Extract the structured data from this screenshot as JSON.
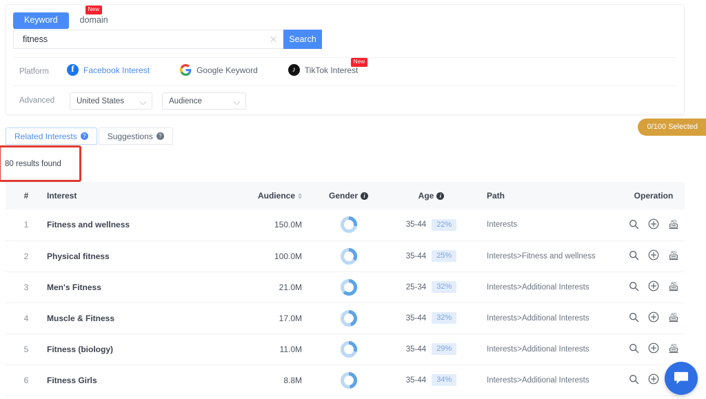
{
  "search_panel": {
    "mode_tabs": [
      {
        "label": "Keyword",
        "active": true,
        "badge": null
      },
      {
        "label": "domain",
        "active": false,
        "badge": "New"
      }
    ],
    "search_value": "fitness",
    "search_placeholder": "",
    "search_button": "Search",
    "platform_label": "Platform",
    "platforms": [
      {
        "label": "Facebook Interest",
        "icon": "facebook-icon",
        "active": true,
        "badge": null
      },
      {
        "label": "Google Keyword",
        "icon": "google-icon",
        "active": false,
        "badge": null
      },
      {
        "label": "TikTok Interest",
        "icon": "tiktok-icon",
        "active": false,
        "badge": "New"
      }
    ],
    "advanced_label": "Advanced",
    "advanced_selects": [
      {
        "value": "United States"
      },
      {
        "value": "Audience"
      }
    ]
  },
  "result_tabs": [
    {
      "label": "Related Interests",
      "active": true
    },
    {
      "label": "Suggestions",
      "active": false
    }
  ],
  "results_found": "80 results found",
  "selected_badge": "0/100 Selected",
  "table": {
    "columns": [
      {
        "key": "num",
        "label": "#"
      },
      {
        "key": "int",
        "label": "Interest"
      },
      {
        "key": "aud",
        "label": "Audience",
        "sortable": true
      },
      {
        "key": "gen",
        "label": "Gender",
        "info": true
      },
      {
        "key": "age",
        "label": "Age",
        "info": true
      },
      {
        "key": "path",
        "label": "Path"
      },
      {
        "key": "op",
        "label": "Operation"
      }
    ],
    "rows": [
      {
        "num": "1",
        "interest": "Fitness and wellness",
        "audience": "150.0M",
        "gender_pct": 28,
        "age_range": "35-44",
        "age_pct": "22%",
        "path": "Interests"
      },
      {
        "num": "2",
        "interest": "Physical fitness",
        "audience": "100.0M",
        "gender_pct": 34,
        "age_range": "35-44",
        "age_pct": "25%",
        "path": "Interests>Fitness and wellness"
      },
      {
        "num": "3",
        "interest": "Men's Fitness",
        "audience": "21.0M",
        "gender_pct": 62,
        "age_range": "25-34",
        "age_pct": "32%",
        "path": "Interests>Additional Interests"
      },
      {
        "num": "4",
        "interest": "Muscle & Fitness",
        "audience": "17.0M",
        "gender_pct": 45,
        "age_range": "35-44",
        "age_pct": "32%",
        "path": "Interests>Additional Interests"
      },
      {
        "num": "5",
        "interest": "Fitness (biology)",
        "audience": "11.0M",
        "gender_pct": 30,
        "age_range": "35-44",
        "age_pct": "29%",
        "path": "Interests>Additional Interests"
      },
      {
        "num": "6",
        "interest": "Fitness Girls",
        "audience": "8.8M",
        "gender_pct": 47,
        "age_range": "35-44",
        "age_pct": "34%",
        "path": "Interests>Additional Interests"
      }
    ],
    "operations": [
      {
        "name": "search-icon",
        "title": "Search"
      },
      {
        "name": "add-icon",
        "title": "Add"
      },
      {
        "name": "ad-icon",
        "title": "AD"
      }
    ]
  },
  "colors": {
    "accent_blue": "#4a8cf7",
    "badge_gold": "#d6a03c",
    "new_red": "#f5222d",
    "annotation_red": "#e03a2f",
    "donut_track": "#bcd9f5",
    "donut_arc": "#5ea3e8",
    "chat_blue": "#2f6fe4"
  },
  "chat_widget": {
    "name": "chat-bubble"
  }
}
